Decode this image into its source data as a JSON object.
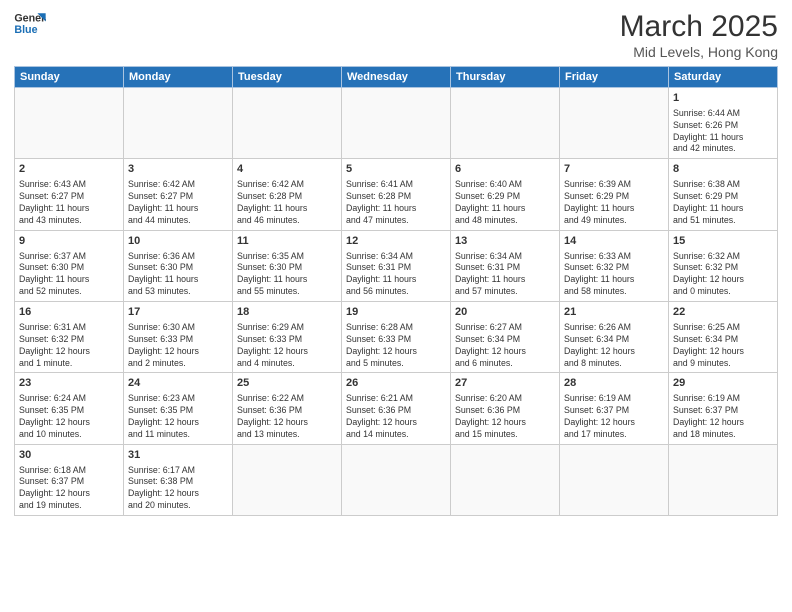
{
  "logo": {
    "text_general": "General",
    "text_blue": "Blue"
  },
  "header": {
    "month": "March 2025",
    "location": "Mid Levels, Hong Kong"
  },
  "weekdays": [
    "Sunday",
    "Monday",
    "Tuesday",
    "Wednesday",
    "Thursday",
    "Friday",
    "Saturday"
  ],
  "weeks": [
    [
      {
        "day": "",
        "info": ""
      },
      {
        "day": "",
        "info": ""
      },
      {
        "day": "",
        "info": ""
      },
      {
        "day": "",
        "info": ""
      },
      {
        "day": "",
        "info": ""
      },
      {
        "day": "",
        "info": ""
      },
      {
        "day": "1",
        "info": "Sunrise: 6:44 AM\nSunset: 6:26 PM\nDaylight: 11 hours\nand 42 minutes."
      }
    ],
    [
      {
        "day": "2",
        "info": "Sunrise: 6:43 AM\nSunset: 6:27 PM\nDaylight: 11 hours\nand 43 minutes."
      },
      {
        "day": "3",
        "info": "Sunrise: 6:42 AM\nSunset: 6:27 PM\nDaylight: 11 hours\nand 44 minutes."
      },
      {
        "day": "4",
        "info": "Sunrise: 6:42 AM\nSunset: 6:28 PM\nDaylight: 11 hours\nand 46 minutes."
      },
      {
        "day": "5",
        "info": "Sunrise: 6:41 AM\nSunset: 6:28 PM\nDaylight: 11 hours\nand 47 minutes."
      },
      {
        "day": "6",
        "info": "Sunrise: 6:40 AM\nSunset: 6:29 PM\nDaylight: 11 hours\nand 48 minutes."
      },
      {
        "day": "7",
        "info": "Sunrise: 6:39 AM\nSunset: 6:29 PM\nDaylight: 11 hours\nand 49 minutes."
      },
      {
        "day": "8",
        "info": "Sunrise: 6:38 AM\nSunset: 6:29 PM\nDaylight: 11 hours\nand 51 minutes."
      }
    ],
    [
      {
        "day": "9",
        "info": "Sunrise: 6:37 AM\nSunset: 6:30 PM\nDaylight: 11 hours\nand 52 minutes."
      },
      {
        "day": "10",
        "info": "Sunrise: 6:36 AM\nSunset: 6:30 PM\nDaylight: 11 hours\nand 53 minutes."
      },
      {
        "day": "11",
        "info": "Sunrise: 6:35 AM\nSunset: 6:30 PM\nDaylight: 11 hours\nand 55 minutes."
      },
      {
        "day": "12",
        "info": "Sunrise: 6:34 AM\nSunset: 6:31 PM\nDaylight: 11 hours\nand 56 minutes."
      },
      {
        "day": "13",
        "info": "Sunrise: 6:34 AM\nSunset: 6:31 PM\nDaylight: 11 hours\nand 57 minutes."
      },
      {
        "day": "14",
        "info": "Sunrise: 6:33 AM\nSunset: 6:32 PM\nDaylight: 11 hours\nand 58 minutes."
      },
      {
        "day": "15",
        "info": "Sunrise: 6:32 AM\nSunset: 6:32 PM\nDaylight: 12 hours\nand 0 minutes."
      }
    ],
    [
      {
        "day": "16",
        "info": "Sunrise: 6:31 AM\nSunset: 6:32 PM\nDaylight: 12 hours\nand 1 minute."
      },
      {
        "day": "17",
        "info": "Sunrise: 6:30 AM\nSunset: 6:33 PM\nDaylight: 12 hours\nand 2 minutes."
      },
      {
        "day": "18",
        "info": "Sunrise: 6:29 AM\nSunset: 6:33 PM\nDaylight: 12 hours\nand 4 minutes."
      },
      {
        "day": "19",
        "info": "Sunrise: 6:28 AM\nSunset: 6:33 PM\nDaylight: 12 hours\nand 5 minutes."
      },
      {
        "day": "20",
        "info": "Sunrise: 6:27 AM\nSunset: 6:34 PM\nDaylight: 12 hours\nand 6 minutes."
      },
      {
        "day": "21",
        "info": "Sunrise: 6:26 AM\nSunset: 6:34 PM\nDaylight: 12 hours\nand 8 minutes."
      },
      {
        "day": "22",
        "info": "Sunrise: 6:25 AM\nSunset: 6:34 PM\nDaylight: 12 hours\nand 9 minutes."
      }
    ],
    [
      {
        "day": "23",
        "info": "Sunrise: 6:24 AM\nSunset: 6:35 PM\nDaylight: 12 hours\nand 10 minutes."
      },
      {
        "day": "24",
        "info": "Sunrise: 6:23 AM\nSunset: 6:35 PM\nDaylight: 12 hours\nand 11 minutes."
      },
      {
        "day": "25",
        "info": "Sunrise: 6:22 AM\nSunset: 6:36 PM\nDaylight: 12 hours\nand 13 minutes."
      },
      {
        "day": "26",
        "info": "Sunrise: 6:21 AM\nSunset: 6:36 PM\nDaylight: 12 hours\nand 14 minutes."
      },
      {
        "day": "27",
        "info": "Sunrise: 6:20 AM\nSunset: 6:36 PM\nDaylight: 12 hours\nand 15 minutes."
      },
      {
        "day": "28",
        "info": "Sunrise: 6:19 AM\nSunset: 6:37 PM\nDaylight: 12 hours\nand 17 minutes."
      },
      {
        "day": "29",
        "info": "Sunrise: 6:19 AM\nSunset: 6:37 PM\nDaylight: 12 hours\nand 18 minutes."
      }
    ],
    [
      {
        "day": "30",
        "info": "Sunrise: 6:18 AM\nSunset: 6:37 PM\nDaylight: 12 hours\nand 19 minutes."
      },
      {
        "day": "31",
        "info": "Sunrise: 6:17 AM\nSunset: 6:38 PM\nDaylight: 12 hours\nand 20 minutes."
      },
      {
        "day": "",
        "info": ""
      },
      {
        "day": "",
        "info": ""
      },
      {
        "day": "",
        "info": ""
      },
      {
        "day": "",
        "info": ""
      },
      {
        "day": "",
        "info": ""
      }
    ]
  ]
}
